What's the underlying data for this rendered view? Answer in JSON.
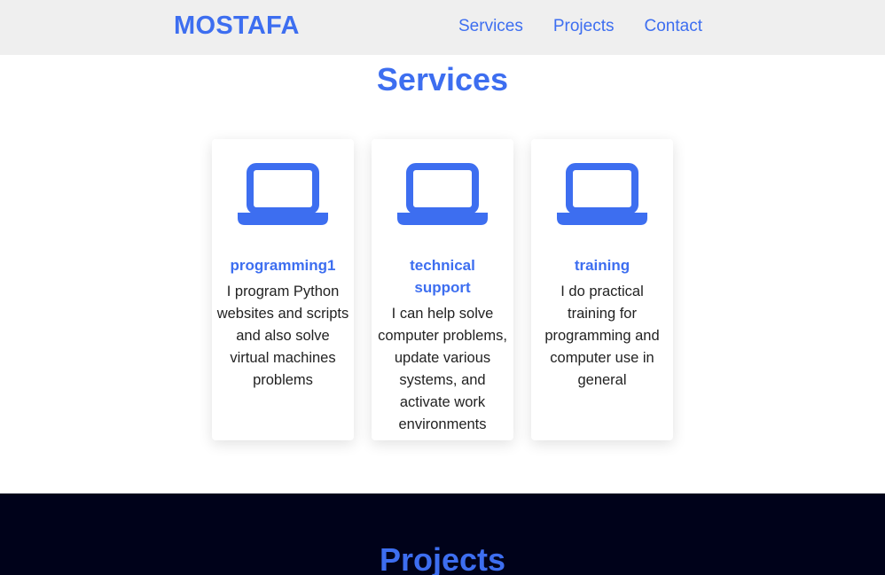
{
  "header": {
    "logo": "MOSTAFA",
    "nav": [
      {
        "label": "Services"
      },
      {
        "label": "Projects"
      },
      {
        "label": "Contact"
      }
    ]
  },
  "services": {
    "title": "Services",
    "cards": [
      {
        "icon": "laptop-icon",
        "title": "programming1",
        "description": "I program Python websites and scripts and also solve virtual machines problems"
      },
      {
        "icon": "laptop-icon",
        "title": "technical support",
        "description": "I can help solve computer problems, update various systems, and activate work environments"
      },
      {
        "icon": "laptop-icon",
        "title": "training",
        "description": "I do practical training for programming and computer use in general"
      }
    ]
  },
  "projects": {
    "title": "Projects"
  },
  "colors": {
    "accent": "#3d6ef0",
    "nav_background": "#efefef",
    "projects_background": "#00021a",
    "text": "#222222"
  }
}
